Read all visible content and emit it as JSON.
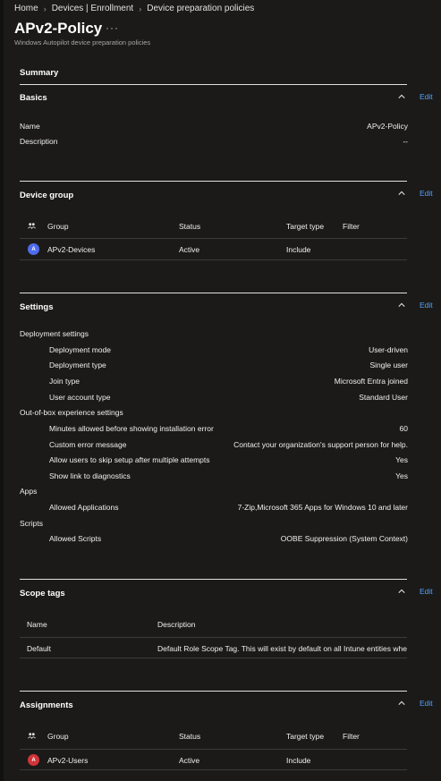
{
  "breadcrumb": {
    "items": [
      "Home",
      "Devices | Enrollment",
      "Device preparation policies"
    ]
  },
  "page": {
    "title": "APv2-Policy",
    "more": "···",
    "subtitle": "Windows Autopilot device preparation policies",
    "summary": "Summary"
  },
  "edit_label": "Edit",
  "basics": {
    "title": "Basics",
    "rows": [
      {
        "label": "Name",
        "value": "APv2-Policy"
      },
      {
        "label": "Description",
        "value": "--"
      }
    ]
  },
  "device_group": {
    "title": "Device group",
    "headers": {
      "group": "Group",
      "status": "Status",
      "target": "Target type",
      "filter": "Filter"
    },
    "row": {
      "avatar": "A",
      "group": "APv2-Devices",
      "status": "Active",
      "target": "Include",
      "filter": ""
    }
  },
  "settings": {
    "title": "Settings",
    "deployment": {
      "heading": "Deployment settings",
      "rows": [
        {
          "label": "Deployment mode",
          "value": "User-driven"
        },
        {
          "label": "Deployment type",
          "value": "Single user"
        },
        {
          "label": "Join type",
          "value": "Microsoft Entra joined"
        },
        {
          "label": "User account type",
          "value": "Standard User"
        }
      ]
    },
    "oobe": {
      "heading": "Out-of-box experience settings",
      "rows": [
        {
          "label": "Minutes allowed before showing installation error",
          "value": "60"
        },
        {
          "label": "Custom error message",
          "value": "Contact your organization's support person for help."
        },
        {
          "label": "Allow users to skip setup after multiple attempts",
          "value": "Yes"
        },
        {
          "label": "Show link to diagnostics",
          "value": "Yes"
        }
      ]
    },
    "apps": {
      "heading": "Apps",
      "label": "Allowed Applications",
      "value": "7-Zip,Microsoft 365 Apps for Windows 10 and later"
    },
    "scripts": {
      "heading": "Scripts",
      "label": "Allowed Scripts",
      "value": "OOBE Suppression (System Context)"
    }
  },
  "scope_tags": {
    "title": "Scope tags",
    "headers": {
      "name": "Name",
      "description": "Description"
    },
    "row": {
      "name": "Default",
      "description": "Default Role Scope Tag. This will exist by default on all Intune entities whe"
    }
  },
  "assignments": {
    "title": "Assignments",
    "headers": {
      "group": "Group",
      "status": "Status",
      "target": "Target type",
      "filter": "Filter"
    },
    "row": {
      "avatar": "A",
      "group": "APv2-Users",
      "status": "Active",
      "target": "Include",
      "filter": ""
    }
  },
  "colors": {
    "accent": "#4fa3ff",
    "panel": "#1b1a19",
    "group_avatar": "#4f6bed",
    "user_avatar": "#d13438"
  }
}
